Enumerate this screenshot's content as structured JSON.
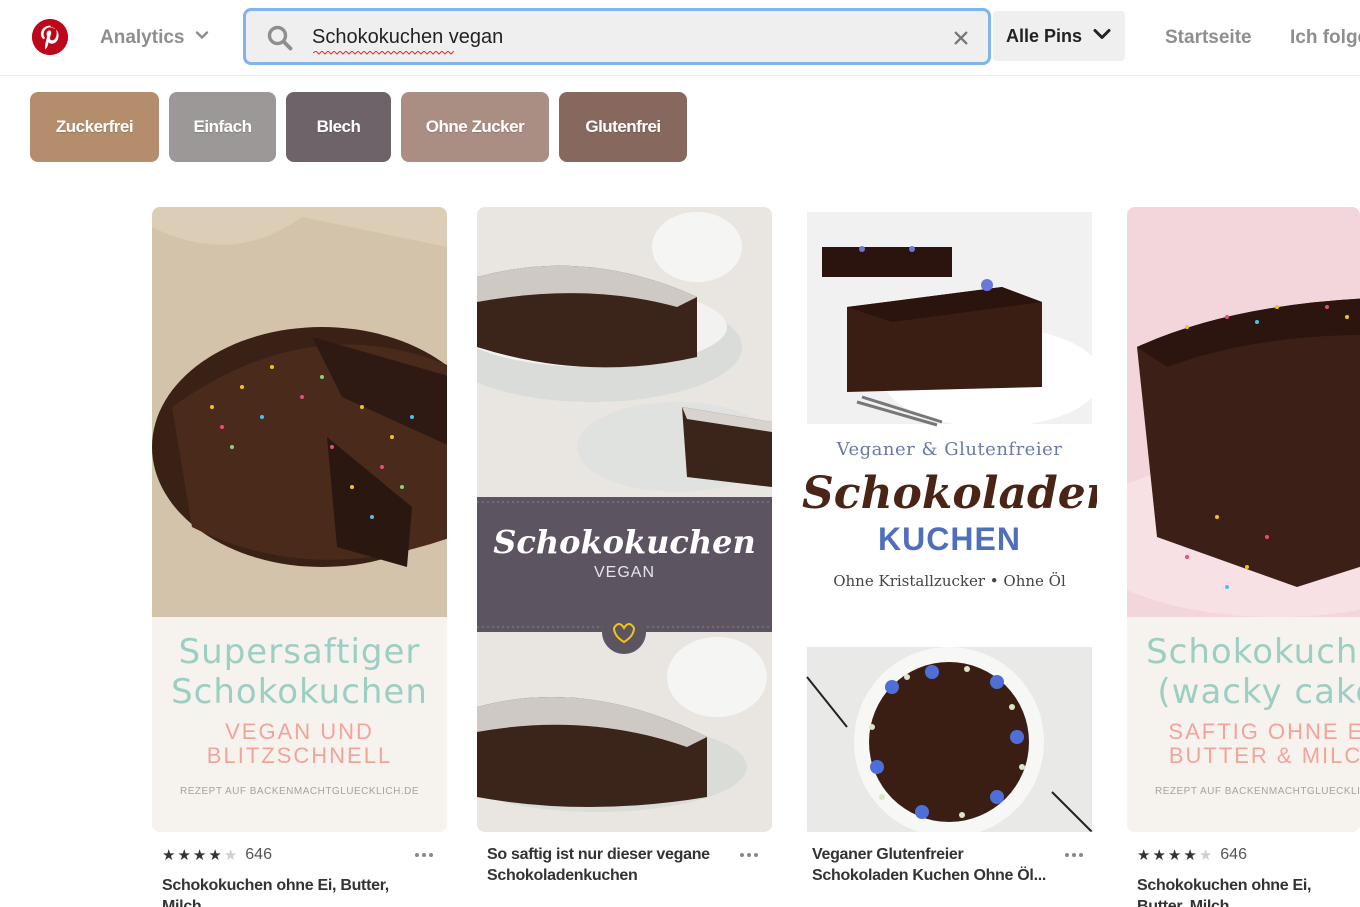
{
  "header": {
    "analytics_label": "Analytics",
    "search_value": "Schokokuchen vegan",
    "scope_label": "Alle Pins",
    "nav": [
      "Startseite",
      "Ich folge"
    ]
  },
  "chips": [
    {
      "label": "Zuckerfrei",
      "color": "#b38d6c"
    },
    {
      "label": "Einfach",
      "color": "#9c9898"
    },
    {
      "label": "Blech",
      "color": "#6e6369"
    },
    {
      "label": "Ohne Zucker",
      "color": "#ab8e83"
    },
    {
      "label": "Glutenfrei",
      "color": "#87685e"
    }
  ],
  "pins": [
    {
      "overlay_lines": [
        "Supersaftiger",
        "Schokokuchen",
        "VEGAN UND",
        "BLITZSCHNELL",
        "REZEPT AUF BACKENMACHTGLUECKLICH.DE"
      ],
      "rating": "3.5",
      "rating_count": "646",
      "title": "Schokokuchen ohne Ei, Butter, Milch"
    },
    {
      "overlay_lines": [
        "Schokokuchen",
        "VEGAN"
      ],
      "title": "So saftig ist nur dieser vegane Schokoladenkuchen"
    },
    {
      "overlay_lines": [
        "Veganer & Glutenfreier",
        "Schokoladen",
        "KUCHEN",
        "Ohne Kristallzucker • Ohne Öl"
      ],
      "title": "Veganer Glutenfreier Schokoladen Kuchen Ohne Öl..."
    },
    {
      "overlay_lines": [
        "Schokokuchen",
        "(wacky cake)",
        "SAFTIG OHNE EI,",
        "BUTTER & MILCH",
        "REZEPT AUF BACKENMACHTGLUECKLICH.DE"
      ],
      "rating": "3.5",
      "rating_count": "646",
      "title": "Schokokuchen ohne Ei, Butter, Milch"
    }
  ],
  "colors": {
    "brand": "#bd081c",
    "search_focus": "#7fb5ec"
  }
}
